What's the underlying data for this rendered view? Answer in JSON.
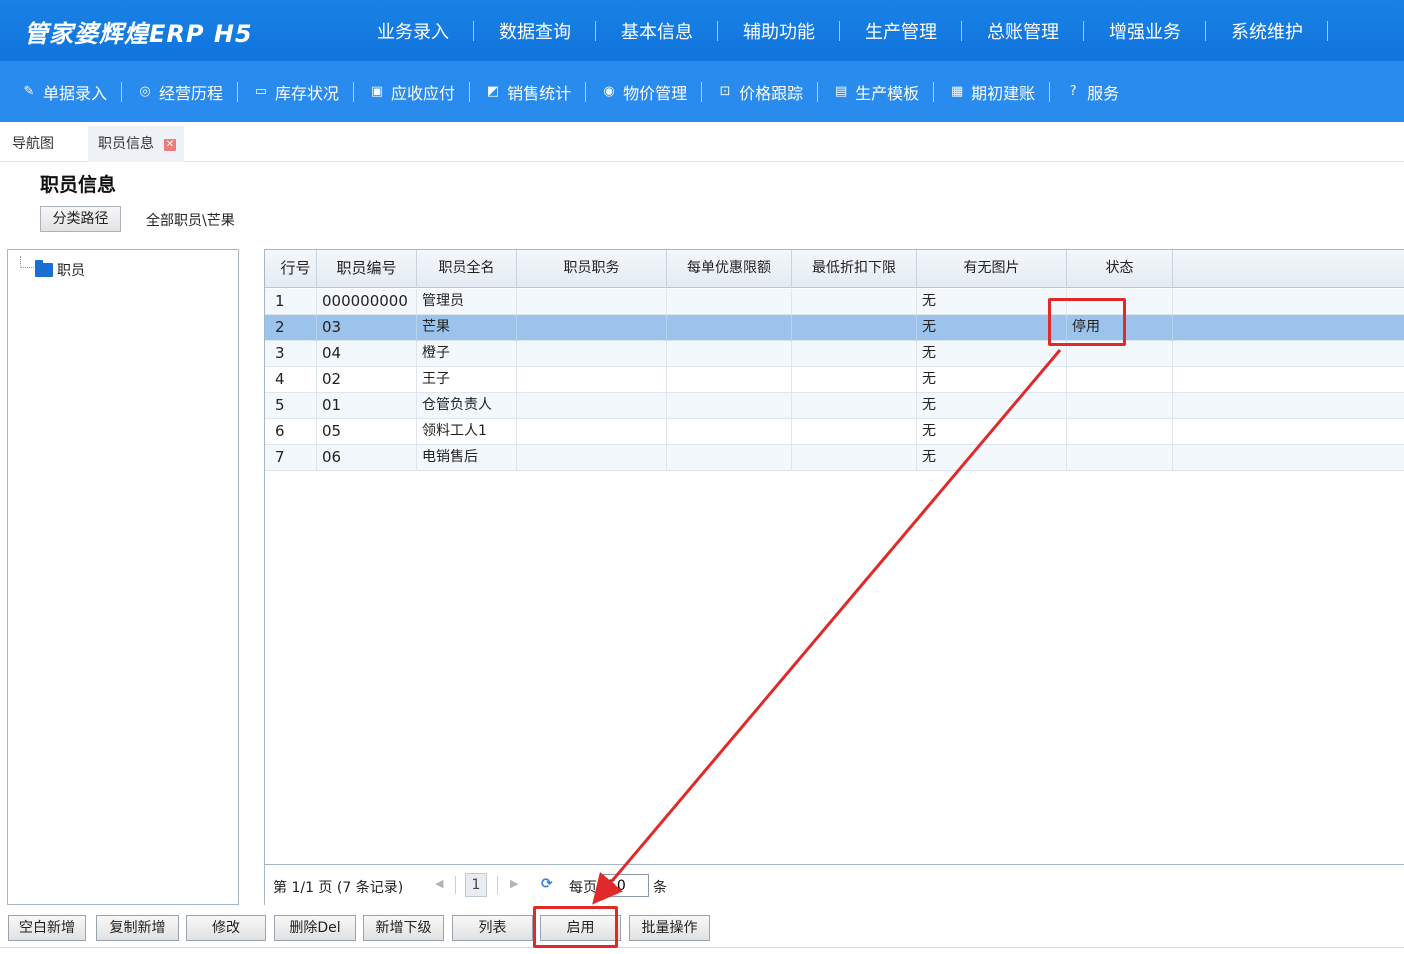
{
  "app": {
    "logo": "管家婆辉煌ERP H5",
    "main_menu": [
      "业务录入",
      "数据查询",
      "基本信息",
      "辅助功能",
      "生产管理",
      "总账管理",
      "增强业务",
      "系统维护"
    ],
    "sub_menu": [
      {
        "icon": "edit-icon",
        "glyph": "✎",
        "label": "单据录入"
      },
      {
        "icon": "check-circle-icon",
        "glyph": "◎",
        "label": "经营历程"
      },
      {
        "icon": "calendar-icon",
        "glyph": "▭",
        "label": "库存状况"
      },
      {
        "icon": "receivable-icon",
        "glyph": "▣",
        "label": "应收应付"
      },
      {
        "icon": "chart-icon",
        "glyph": "◩",
        "label": "销售统计"
      },
      {
        "icon": "price-icon",
        "glyph": "◉",
        "label": "物价管理"
      },
      {
        "icon": "tracking-icon",
        "glyph": "⊡",
        "label": "价格跟踪"
      },
      {
        "icon": "template-icon",
        "glyph": "▤",
        "label": "生产模板"
      },
      {
        "icon": "ledger-icon",
        "glyph": "▦",
        "label": "期初建账"
      },
      {
        "icon": "help-icon",
        "glyph": "?",
        "label": "服务"
      }
    ]
  },
  "tabs": {
    "nav": "导航图",
    "active": "职员信息",
    "close_glyph": "✕"
  },
  "page": {
    "title": "职员信息",
    "path_button": "分类路径",
    "path_text": "全部职员\\芒果"
  },
  "tree": {
    "root": "职员"
  },
  "grid": {
    "headers": [
      "行号",
      "职员编号",
      "职员全名",
      "职员职务",
      "每单优惠限额",
      "最低折扣下限",
      "有无图片",
      "状态"
    ],
    "rows": [
      [
        "1",
        "000000000",
        "管理员",
        "",
        "",
        "",
        "无",
        ""
      ],
      [
        "2",
        "03",
        "芒果",
        "",
        "",
        "",
        "无",
        "停用"
      ],
      [
        "3",
        "04",
        "橙子",
        "",
        "",
        "",
        "无",
        ""
      ],
      [
        "4",
        "02",
        "王子",
        "",
        "",
        "",
        "无",
        ""
      ],
      [
        "5",
        "01",
        "仓管负责人",
        "",
        "",
        "",
        "无",
        ""
      ],
      [
        "6",
        "05",
        "领料工人1",
        "",
        "",
        "",
        "无",
        ""
      ],
      [
        "7",
        "06",
        "电销售后",
        "",
        "",
        "",
        "无",
        ""
      ]
    ],
    "selected_row": 2
  },
  "pager": {
    "summary": "第 1/1 页 (7 条记录)",
    "page": "1",
    "per_page_label": "每页",
    "per_page_value": "50",
    "unit": "条",
    "refresh_glyph": "⟳"
  },
  "buttons": [
    "空白新增",
    "复制新增",
    "修改",
    "删除Del",
    "新增下级",
    "列表",
    "启用",
    "批量操作"
  ],
  "colors": {
    "topbar": "#0f74dc",
    "subbar": "#2a8bee",
    "selected_row": "#9cc3ec",
    "annotation": "#e02a2a"
  }
}
